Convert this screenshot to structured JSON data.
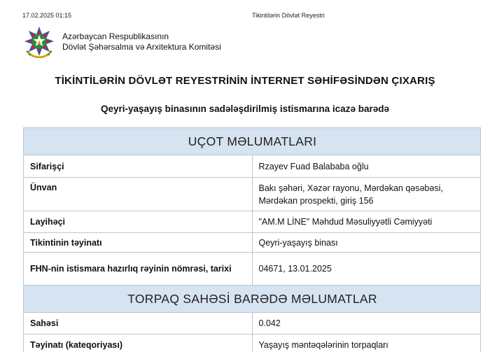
{
  "print_header": {
    "datetime": "17.02.2025 01:15",
    "title": "Tikintilərin Dövlət Reyestri"
  },
  "organization": {
    "line1": "Azərbaycan Respublikasının",
    "line2": "Dövlət Şəhərsalma və Arxitektura Komitəsi",
    "emblem_icon": "azerbaijan-coat-of-arms-icon"
  },
  "document": {
    "title": "TİKİNTİLƏRİN DÖVLƏT REYESTRİNİN İNTERNET SƏHİFƏSİNDƏN ÇIXARIŞ",
    "subtitle": "Qeyri-yaşayış binasının sadələşdirilmiş istismarına icazə barədə"
  },
  "sections": [
    {
      "heading": "UÇOT MƏLUMATLARI",
      "rows": [
        {
          "label": "Sifarişçi",
          "value": "Rzayev Fuad Balababa oğlu"
        },
        {
          "label": "Ünvan",
          "value": "Bakı şəhəri, Xəzər rayonu, Mərdəkan qəsəbəsi, Mərdəkan prospekti, giriş 156"
        },
        {
          "label": "Layihəçi",
          "value": "\"AM.M LİNE\" Məhdud Məsuliyyətli Cəmiyyəti"
        },
        {
          "label": "Tikintinin təyinatı",
          "value": "Qeyri-yaşayış binası"
        },
        {
          "label": "FHN-nin istismara hazırlıq rəyinin nömrəsi, tarixi",
          "value": "04671, 13.01.2025"
        }
      ]
    },
    {
      "heading": "TORPAQ SAHƏSİ BARƏDƏ MƏLUMATLAR",
      "rows": [
        {
          "label": "Sahəsi",
          "value": "0.042"
        },
        {
          "label": "Təyinatı (kateqoriyası)",
          "value": "Yaşayış məntəqələrinin torpaqları"
        }
      ]
    }
  ],
  "colors": {
    "section_header_bg": "#d6e3f1",
    "border": "#b9c6d3",
    "emblem_blue": "#1f5fa8",
    "emblem_red": "#c8262c",
    "emblem_green": "#2e8b3a",
    "emblem_gold": "#d4a20f"
  }
}
